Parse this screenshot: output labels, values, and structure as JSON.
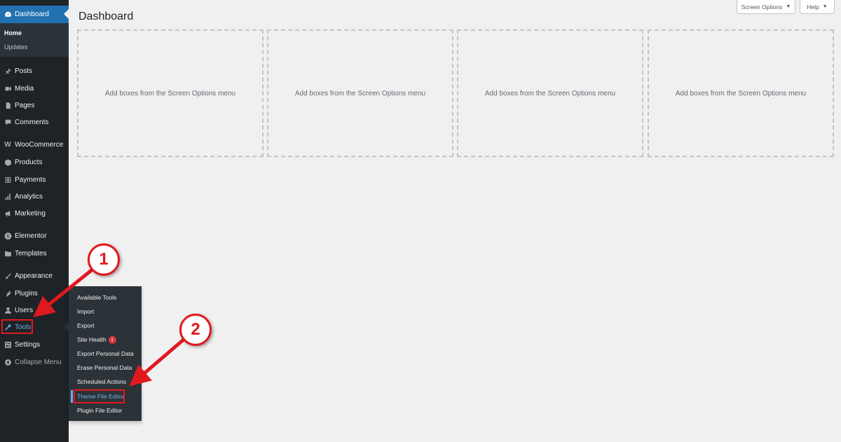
{
  "sidebar": {
    "dashboard": {
      "label": "Dashboard",
      "icon": "dashboard-icon"
    },
    "dashboard_sub": [
      {
        "label": "Home"
      },
      {
        "label": "Updates"
      }
    ],
    "items": [
      {
        "label": "Posts",
        "icon": "pin-icon"
      },
      {
        "label": "Media",
        "icon": "media-icon"
      },
      {
        "label": "Pages",
        "icon": "page-icon"
      },
      {
        "label": "Comments",
        "icon": "comment-icon"
      },
      {
        "label": "WooCommerce",
        "icon": "woocommerce-icon"
      },
      {
        "label": "Products",
        "icon": "products-icon"
      },
      {
        "label": "Payments",
        "icon": "payments-icon"
      },
      {
        "label": "Analytics",
        "icon": "analytics-icon"
      },
      {
        "label": "Marketing",
        "icon": "megaphone-icon"
      },
      {
        "label": "Elementor",
        "icon": "elementor-icon"
      },
      {
        "label": "Templates",
        "icon": "folder-icon"
      },
      {
        "label": "Appearance",
        "icon": "brush-icon"
      },
      {
        "label": "Plugins",
        "icon": "plug-icon"
      },
      {
        "label": "Users",
        "icon": "user-icon"
      },
      {
        "label": "Tools",
        "icon": "wrench-icon"
      },
      {
        "label": "Settings",
        "icon": "settings-icon"
      },
      {
        "label": "Collapse Menu",
        "icon": "collapse-icon"
      }
    ]
  },
  "tools_submenu": [
    {
      "label": "Available Tools"
    },
    {
      "label": "Import"
    },
    {
      "label": "Export"
    },
    {
      "label": "Site Health",
      "badge": "1"
    },
    {
      "label": "Export Personal Data"
    },
    {
      "label": "Erase Personal Data"
    },
    {
      "label": "Scheduled Actions"
    },
    {
      "label": "Theme File Editor"
    },
    {
      "label": "Plugin File Editor"
    }
  ],
  "header": {
    "title": "Dashboard",
    "screen_options": "Screen Options",
    "help": "Help"
  },
  "boxes": [
    {
      "text": "Add boxes from the Screen Options menu"
    },
    {
      "text": "Add boxes from the Screen Options menu"
    },
    {
      "text": "Add boxes from the Screen Options menu"
    },
    {
      "text": "Add boxes from the Screen Options menu"
    }
  ],
  "annotations": {
    "step1": "1",
    "step2": "2",
    "color": "#e0191f"
  },
  "colors": {
    "sidebar_bg": "#1d2327",
    "accent": "#2271b1",
    "active_text": "#72aee6"
  }
}
